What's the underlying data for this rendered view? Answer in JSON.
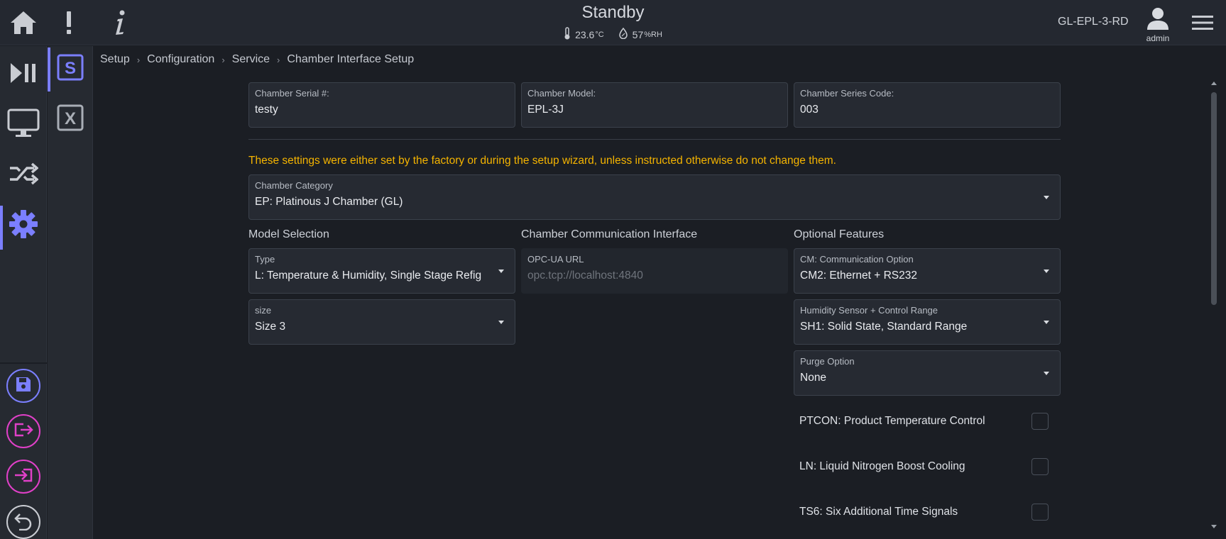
{
  "header": {
    "status": "Standby",
    "temperature": {
      "value": "23.6",
      "unit": "°C"
    },
    "humidity": {
      "value": "57",
      "unit": "%RH"
    },
    "device_name": "GL-EPL-3-RD",
    "user": "admin",
    "icons": [
      "home-icon",
      "alert-icon",
      "info-icon",
      "user-icon",
      "menu-icon",
      "thermometer-icon",
      "humidity-icon"
    ]
  },
  "left_rail": {
    "items": [
      {
        "name": "run-control",
        "icon": "play-pause-icon"
      },
      {
        "name": "monitor",
        "icon": "monitor-icon"
      },
      {
        "name": "transfer",
        "icon": "shuffle-icon"
      },
      {
        "name": "settings",
        "icon": "gear-icon",
        "active": true
      }
    ],
    "actions": [
      {
        "name": "save",
        "icon": "save-icon",
        "color": "#7b7fff"
      },
      {
        "name": "export",
        "icon": "export-icon",
        "color": "#e040c8"
      },
      {
        "name": "import",
        "icon": "import-icon",
        "color": "#e040c8"
      },
      {
        "name": "undo",
        "icon": "undo-icon",
        "color": "#c9ccd2"
      }
    ]
  },
  "sub_rail": {
    "items": [
      {
        "glyph": "S",
        "name": "s-icon",
        "active": true
      },
      {
        "glyph": "X",
        "name": "x-icon",
        "active": false
      }
    ]
  },
  "breadcrumb": [
    "Setup",
    "Configuration",
    "Service",
    "Chamber Interface Setup"
  ],
  "fields": {
    "serial": {
      "label": "Chamber Serial #:",
      "value": "testy"
    },
    "model": {
      "label": "Chamber Model:",
      "value": "EPL-3J"
    },
    "series": {
      "label": "Chamber Series Code:",
      "value": "003"
    },
    "category": {
      "label": "Chamber Category",
      "value": "EP: Platinous J Chamber (GL)"
    },
    "type": {
      "label": "Type",
      "value": "L: Temperature & Humidity, Single Stage Refig"
    },
    "size": {
      "label": "size",
      "value": "Size 3"
    },
    "opcua": {
      "label": "OPC-UA URL",
      "placeholder": "opc.tcp://localhost:4840"
    },
    "cm": {
      "label": "CM: Communication Option",
      "value": "CM2: Ethernet + RS232"
    },
    "humidity_sensor": {
      "label": "Humidity Sensor + Control Range",
      "value": "SH1: Solid State, Standard Range"
    },
    "purge": {
      "label": "Purge Option",
      "value": "None"
    }
  },
  "warning": "These settings were either set by the factory or during the setup wizard, unless instructed otherwise do not change them.",
  "sections": {
    "model_selection": "Model Selection",
    "communication": "Chamber Communication Interface",
    "optional": "Optional Features"
  },
  "checkboxes": [
    {
      "label": "PTCON: Product Temperature Control",
      "checked": false
    },
    {
      "label": "LN: Liquid Nitrogen Boost Cooling",
      "checked": false
    },
    {
      "label": "TS6: Six Additional Time Signals",
      "checked": false
    }
  ],
  "colors": {
    "accent": "#7b7fff",
    "magenta": "#e040c8",
    "warning": "#f5b400",
    "background": "#1b1e24",
    "panel": "#242830"
  }
}
